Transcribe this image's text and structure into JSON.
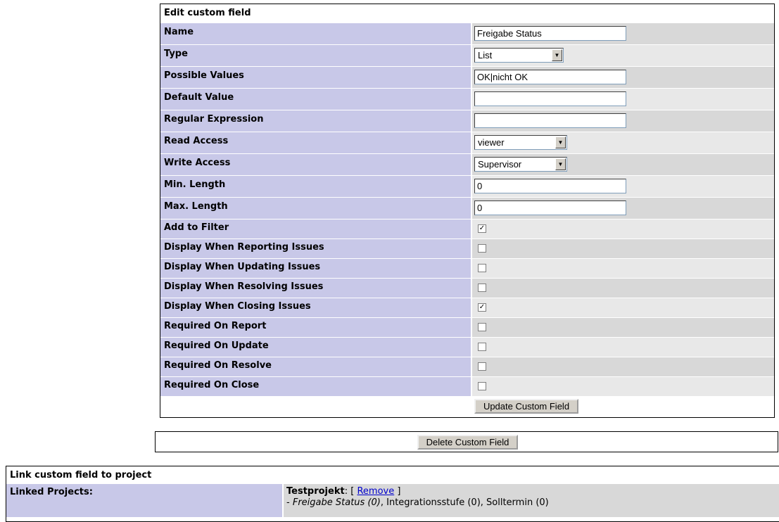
{
  "edit_section": {
    "title": "Edit custom field",
    "fields": {
      "name": {
        "label": "Name",
        "value": "Freigabe Status"
      },
      "type": {
        "label": "Type",
        "value": "List"
      },
      "possible_values": {
        "label": "Possible Values",
        "value": "OK|nicht OK"
      },
      "default_value": {
        "label": "Default Value",
        "value": ""
      },
      "regular_expression": {
        "label": "Regular Expression",
        "value": ""
      },
      "read_access": {
        "label": "Read Access",
        "value": "viewer"
      },
      "write_access": {
        "label": "Write Access",
        "value": "Supervisor"
      },
      "min_length": {
        "label": "Min. Length",
        "value": "0"
      },
      "max_length": {
        "label": "Max. Length",
        "value": "0"
      }
    },
    "checkboxes": [
      {
        "label": "Add to Filter",
        "checked": true
      },
      {
        "label": "Display When Reporting Issues",
        "checked": false
      },
      {
        "label": "Display When Updating Issues",
        "checked": false
      },
      {
        "label": "Display When Resolving Issues",
        "checked": false
      },
      {
        "label": "Display When Closing Issues",
        "checked": true
      },
      {
        "label": "Required On Report",
        "checked": false
      },
      {
        "label": "Required On Update",
        "checked": false
      },
      {
        "label": "Required On Resolve",
        "checked": false
      },
      {
        "label": "Required On Close",
        "checked": false
      }
    ],
    "update_button": "Update Custom Field"
  },
  "delete_section": {
    "delete_button": "Delete Custom Field"
  },
  "link_section": {
    "title": "Link custom field to project",
    "linked_label": "Linked Projects:",
    "project_name": "Testprojekt",
    "project_sep": ":",
    "remove_open": "[",
    "remove_link": "Remove",
    "remove_close": "]",
    "fields_prefix": "-",
    "fields": [
      "Freigabe Status (0)",
      "Integrationsstufe (0)",
      "Solltermin (0)"
    ]
  },
  "colors": {
    "label_bg": "#c8c8e8",
    "row_dark": "#d8d8d8",
    "row_light": "#e8e8e8",
    "link": "#0000cc"
  }
}
